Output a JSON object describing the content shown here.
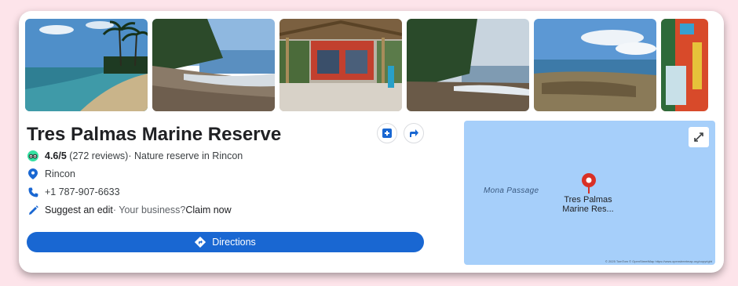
{
  "place": {
    "title": "Tres Palmas Marine Reserve",
    "rating": "4.6/5",
    "reviews": "(272 reviews)",
    "category": " · Nature reserve in Rincon",
    "location": "Rincon",
    "phone": "+1 787-907-6633",
    "suggest_edit": "Suggest an edit",
    "business_prompt": " · Your business? ",
    "claim": "Claim now"
  },
  "directions_label": "Directions",
  "map": {
    "water_label": "Mona Passage",
    "pin_label_line1": "Tres Palmas",
    "pin_label_line2": "Marine Res...",
    "attribution": "© 2025 TomTom © OpenStreetMap https://www.openstreetmap.org/copyright"
  },
  "icons": {
    "save": "add-to-list-icon",
    "share": "share-icon",
    "rating_source": "tripadvisor-icon",
    "location": "location-pin-icon",
    "phone": "phone-icon",
    "edit": "pencil-icon",
    "directions": "directions-icon",
    "expand": "expand-icon"
  },
  "colors": {
    "accent": "#1967d2",
    "map_water": "#a6cffa",
    "pin": "#d93025",
    "page_bg": "#fde4ea"
  }
}
